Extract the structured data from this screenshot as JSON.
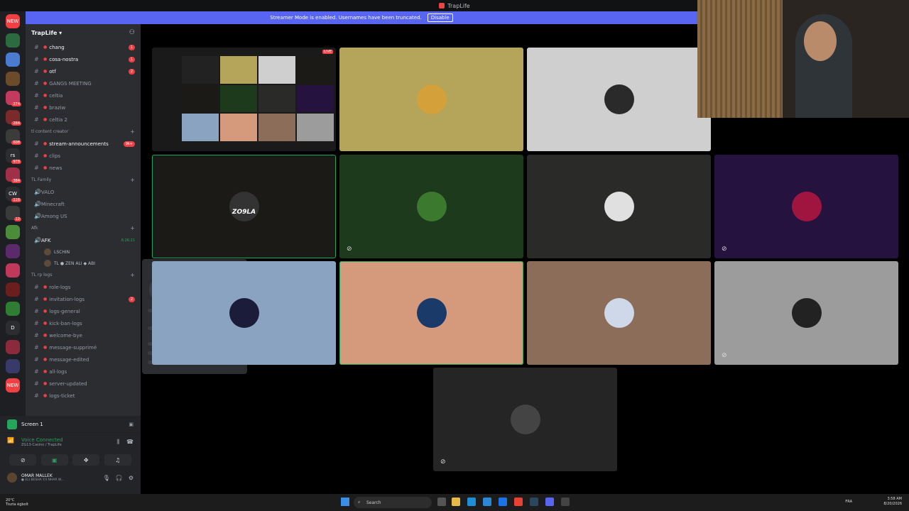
{
  "window": {
    "title": "TrapLife"
  },
  "banner": {
    "text": "Streamer Mode is enabled. Usernames have been truncated.",
    "disable_label": "Disable"
  },
  "rail": {
    "items": [
      {
        "label": "NEW",
        "color": "#f23f43"
      },
      {
        "label": "",
        "color": "#2b6b3f"
      },
      {
        "label": "",
        "color": "#4a7bd0"
      },
      {
        "label": "",
        "color": "#6b4b2a"
      },
      {
        "label": "",
        "color": "#c23b5f"
      },
      {
        "label": "",
        "color": "#7a2a2a"
      },
      {
        "label": "",
        "color": "#3b3b3b"
      },
      {
        "label": "rs",
        "color": "#2b2d31"
      },
      {
        "label": "",
        "color": "#a0304a"
      },
      {
        "label": "CW",
        "color": "#2b2d31"
      },
      {
        "label": "",
        "color": "#3a3a3a"
      },
      {
        "label": "",
        "color": "#4b8c3a"
      },
      {
        "label": "",
        "color": "#5a2a6b"
      },
      {
        "label": "",
        "color": "#c0395a"
      },
      {
        "label": "",
        "color": "#6a1e1e"
      },
      {
        "label": "",
        "color": "#2e7d32"
      },
      {
        "label": "D",
        "color": "#2b2d31"
      },
      {
        "label": "",
        "color": "#8a2a3a"
      },
      {
        "label": "",
        "color": "#3a3a6a"
      },
      {
        "label": "NEW",
        "color": "#f23f43"
      }
    ],
    "badges": [
      "274",
      "284",
      "608",
      "978",
      "384",
      "116",
      "12"
    ]
  },
  "guild": {
    "name": "TrapLife ▾"
  },
  "channels_top": [
    {
      "name": "chang",
      "badge": "1",
      "unread": true
    },
    {
      "name": "cosa-nostra",
      "badge": "1",
      "unread": true
    },
    {
      "name": "otf",
      "badge": "2",
      "unread": true
    },
    {
      "name": "GANGS MEETING",
      "badge": "",
      "unread": false
    },
    {
      "name": "celtia",
      "badge": "",
      "unread": false
    },
    {
      "name": "braziw",
      "badge": "",
      "unread": false
    },
    {
      "name": "celtia 2",
      "badge": "",
      "unread": false
    }
  ],
  "cat_creator": "tl content creator",
  "channels_creator": [
    {
      "name": "stream-announcements",
      "badge": "9k+",
      "unread": true
    },
    {
      "name": "clips",
      "badge": "",
      "unread": false
    },
    {
      "name": "news",
      "badge": "",
      "unread": false
    }
  ],
  "cat_family": "TL Family",
  "channels_family": [
    {
      "name": "VALO"
    },
    {
      "name": "Minecraft"
    },
    {
      "name": "Among US"
    }
  ],
  "cat_afk": "Afk",
  "afk_channel": {
    "name": "AFK",
    "time": "6:26:21"
  },
  "afk_users": [
    {
      "name": "LSCHIN"
    },
    {
      "name": "TL ● ZEN ALI ◆ ABI"
    }
  ],
  "cat_logs": "TL rp logs",
  "channels_logs": [
    {
      "name": "role-logs",
      "badge": ""
    },
    {
      "name": "invitation-logs",
      "badge": "2"
    },
    {
      "name": "logs-general",
      "badge": ""
    },
    {
      "name": "kick-ban-logs",
      "badge": ""
    },
    {
      "name": "welcome-bye",
      "badge": ""
    },
    {
      "name": "message-supprimé",
      "badge": ""
    },
    {
      "name": "message-edited",
      "badge": ""
    },
    {
      "name": "all-logs",
      "badge": ""
    },
    {
      "name": "server-updated",
      "badge": ""
    },
    {
      "name": "logs-ticket",
      "badge": ""
    }
  ],
  "screen_share": {
    "label": "Screen 1"
  },
  "voice": {
    "status": "Voice Connected",
    "channel": "ZG13-Casino / TrapLife"
  },
  "user": {
    "name": "OMAR MALLEK",
    "status": "● ELI BESHA Y.II NHAR W..."
  },
  "tiles": [
    {
      "id": "screen",
      "bg": "#1a1a1a",
      "live": "LIVE"
    },
    {
      "id": "t2",
      "bg": "#b4a55a",
      "avatar_color": "#d4a03a"
    },
    {
      "id": "t3",
      "bg": "#cfcfcf",
      "avatar_color": "#2a2a2a"
    },
    {
      "id": "t4",
      "bg": "#1b1a16",
      "text": "ZO9LA",
      "avatar_color": "#333"
    },
    {
      "id": "t5",
      "bg": "#1d3a1c",
      "avatar_color": "#3b7a2e"
    },
    {
      "id": "t6",
      "bg": "#2a2b28",
      "avatar_color": "#e0e0e0"
    },
    {
      "id": "t7",
      "bg": "#25123f",
      "avatar_color": "#a01540"
    },
    {
      "id": "t8",
      "bg": "#8aa3c0",
      "avatar_color": "#1b1b3a"
    },
    {
      "id": "t9",
      "bg": "#d59a7c",
      "avatar_color": "#1a3a6a"
    },
    {
      "id": "t10",
      "bg": "#8b6d5a",
      "avatar_color": "#cfd8e8"
    },
    {
      "id": "t11",
      "bg": "#9c9c9c",
      "avatar_color": "#222"
    },
    {
      "id": "t12",
      "bg": "#252525",
      "avatar_color": "#444"
    }
  ],
  "taskbar": {
    "weather_temp": "20°C",
    "weather_desc": "Tiszta égbolt",
    "search": "Search",
    "lang": "FRA",
    "time": "3:58 AM",
    "date": "8/20/2026"
  }
}
